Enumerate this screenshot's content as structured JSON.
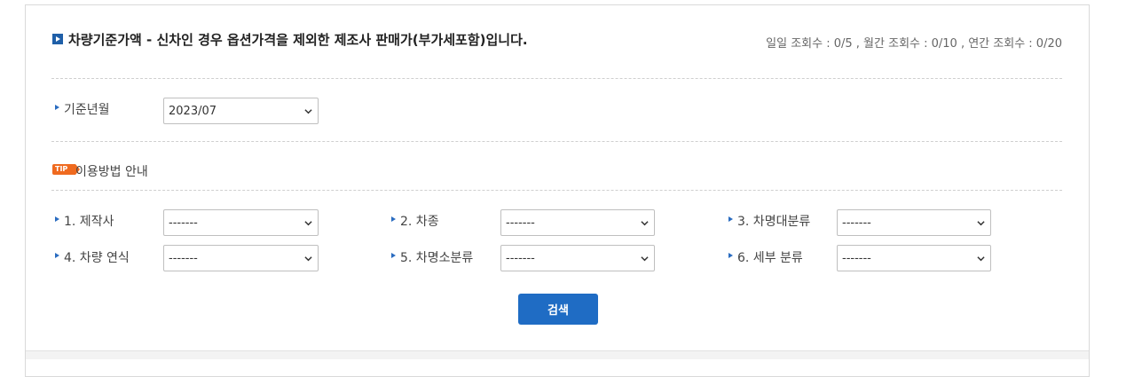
{
  "header": {
    "title": "차량기준가액 - 신차인 경우 옵션가격을 제외한 제조사 판매가(부가세포함)입니다.",
    "counts": "일일 조회수 : 0/5 , 월간 조회수 : 0/10 , 연간 조회수 : 0/20"
  },
  "base_month": {
    "label": "기준년월",
    "value": "2023/07"
  },
  "tip": {
    "badge": "TIP",
    "label": "이용방법 안내"
  },
  "filters": [
    {
      "label": "1. 제작사",
      "value": "-------"
    },
    {
      "label": "2. 차종",
      "value": "-------"
    },
    {
      "label": "3. 차명대분류",
      "value": "-------"
    },
    {
      "label": "4. 차량 연식",
      "value": "-------"
    },
    {
      "label": "5. 차명소분류",
      "value": "-------"
    },
    {
      "label": "6. 세부 분류",
      "value": "-------"
    }
  ],
  "search_button": "검색",
  "colors": {
    "accent": "#1f6cc4",
    "tip": "#ef6a1f",
    "bullet": "#2a6cc0"
  },
  "icons": {
    "title": "title-bullet-icon",
    "dropdown": "chevron-down-icon",
    "field": "arrow-bullet-icon"
  }
}
